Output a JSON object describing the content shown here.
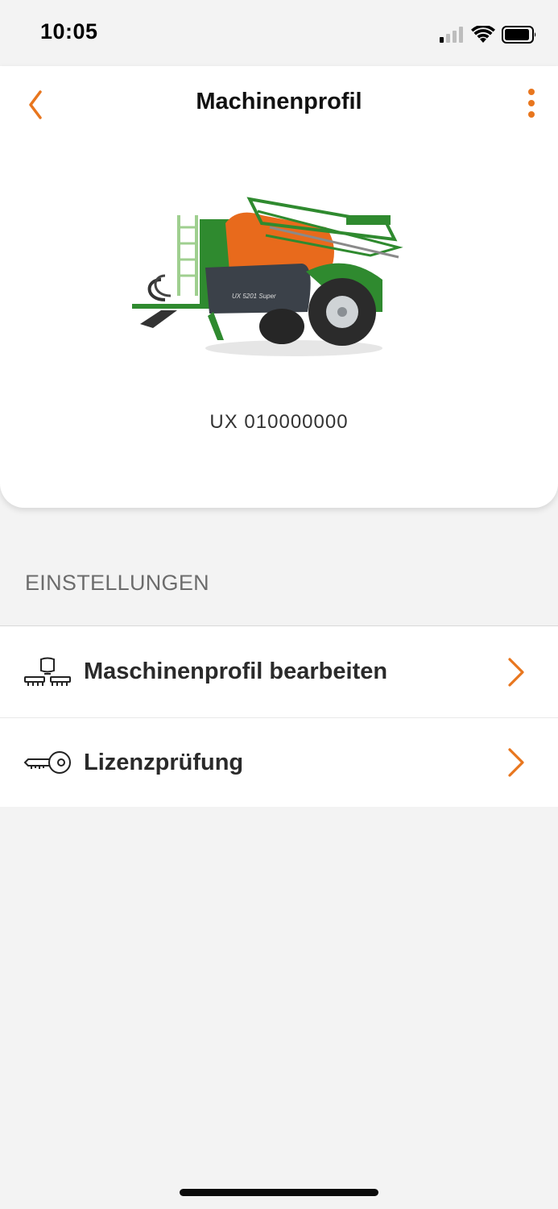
{
  "status_bar": {
    "time": "10:05",
    "icons": [
      "cellular-signal-icon",
      "wifi-icon",
      "battery-icon"
    ]
  },
  "header": {
    "title": "Machinenprofil",
    "back_icon": "chevron-left-icon",
    "menu_icon": "more-vertical-icon"
  },
  "machine": {
    "image_label": "UX 5201 Super",
    "serial": "UX 010000000"
  },
  "settings": {
    "section_title": "EINSTELLUNGEN",
    "items": [
      {
        "label": "Maschinenprofil bearbeiten",
        "icon": "machine-profile-icon"
      },
      {
        "label": "Lizenzprüfung",
        "icon": "key-icon"
      }
    ]
  },
  "colors": {
    "accent": "#e8761e",
    "background": "#f3f3f3",
    "card": "#ffffff",
    "machine_green": "#2f8a2f",
    "machine_orange": "#e86a1c"
  }
}
